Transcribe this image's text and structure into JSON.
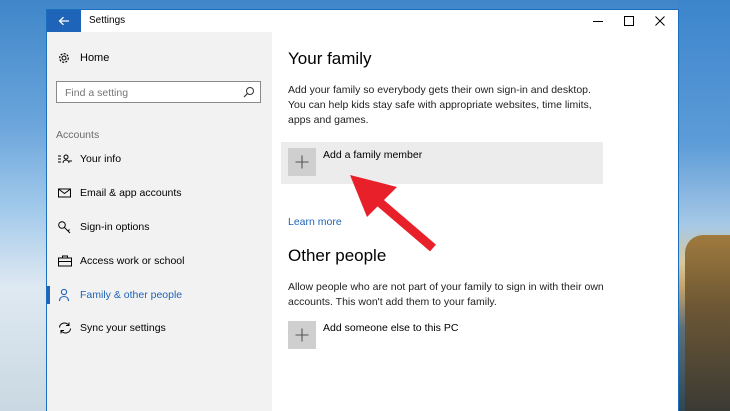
{
  "window": {
    "title": "Settings"
  },
  "sidebar": {
    "home_label": "Home",
    "search_placeholder": "Find a setting",
    "section_label": "Accounts",
    "items": [
      {
        "label": "Your info",
        "icon": "person-card-icon"
      },
      {
        "label": "Email & app accounts",
        "icon": "envelope-icon"
      },
      {
        "label": "Sign-in options",
        "icon": "key-icon"
      },
      {
        "label": "Access work or school",
        "icon": "briefcase-icon"
      },
      {
        "label": "Family & other people",
        "icon": "person-icon",
        "active": true
      },
      {
        "label": "Sync your settings",
        "icon": "sync-icon"
      }
    ]
  },
  "main": {
    "family": {
      "heading": "Your family",
      "description": "Add your family so everybody gets their own sign-in and desktop. You can help kids stay safe with appropriate websites, time limits, apps and games.",
      "add_label": "Add a family member",
      "learn_more": "Learn more"
    },
    "others": {
      "heading": "Other people",
      "description": "Allow people who are not part of your family to sign in with their own accounts. This won't add them to your family.",
      "add_label": "Add someone else to this PC"
    }
  },
  "colors": {
    "accent": "#1e64b8",
    "annotation_arrow": "#e8202a",
    "sidebar_bg": "#f2f2f2"
  }
}
